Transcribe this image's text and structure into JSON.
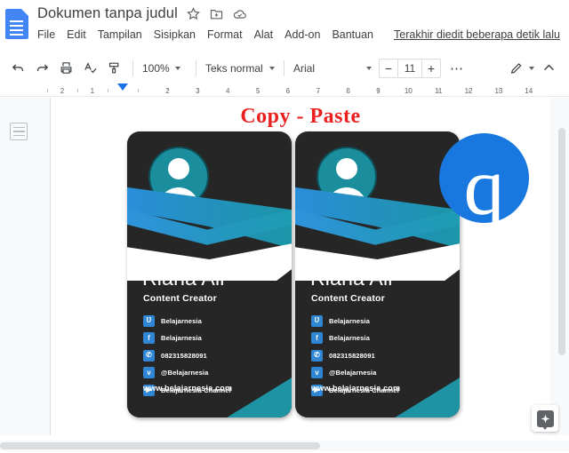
{
  "app": {
    "logo_icon": "google-docs-logo",
    "doc_title": "Dokumen tanpa judul",
    "title_icons": [
      "star-icon",
      "move-to-folder-icon",
      "cloud-saved-icon"
    ],
    "last_edit": "Terakhir diedit beberapa detik lalu"
  },
  "menu": {
    "items": [
      {
        "label": "File"
      },
      {
        "label": "Edit"
      },
      {
        "label": "Tampilan"
      },
      {
        "label": "Sisipkan"
      },
      {
        "label": "Format"
      },
      {
        "label": "Alat"
      },
      {
        "label": "Add-on"
      },
      {
        "label": "Bantuan"
      }
    ]
  },
  "toolbar": {
    "undo_icon": "undo-icon",
    "redo_icon": "redo-icon",
    "print_icon": "print-icon",
    "spellcheck_icon": "spellcheck-icon",
    "paint_format_icon": "paint-format-icon",
    "zoom_value": "100%",
    "paragraph_style": "Teks normal",
    "font_family": "Arial",
    "font_size": "11",
    "decrease_label": "−",
    "increase_label": "+",
    "more_label": "⋯",
    "edit_mode_icon": "pencil-icon",
    "collapse_icon": "chevron-up-icon"
  },
  "ruler": {
    "left_labels": [
      "2",
      "1"
    ],
    "right_labels": [
      "1",
      "2",
      "3",
      "4",
      "5",
      "6",
      "7",
      "8",
      "9",
      "10",
      "11",
      "12",
      "13",
      "14"
    ],
    "indent_marker": "indent-marker"
  },
  "sidebar": {
    "outline_icon": "document-outline-icon"
  },
  "document": {
    "heading": "Copy - Paste",
    "heading_color": "#ea2020",
    "cards": [
      {
        "name": "Riana Ali",
        "role": "Content Creator",
        "avatar_icon": "person-avatar-icon",
        "contacts": [
          {
            "icon": "vine-icon",
            "glyph": "Ʋ",
            "text": "Belajarnesia"
          },
          {
            "icon": "facebook-icon",
            "glyph": "f",
            "text": "Belajarnesia"
          },
          {
            "icon": "phone-icon",
            "glyph": "✆",
            "text": "082315828091"
          },
          {
            "icon": "twitter-icon",
            "glyph": "ᴠ",
            "text": "@Belajarnesia"
          },
          {
            "icon": "youtube-icon",
            "glyph": "▶",
            "text": "Belajarnesia Channel"
          }
        ],
        "website": "www.belajarnesia.com"
      },
      {
        "name": "Riana Ali",
        "role": "Content Creator",
        "avatar_icon": "person-avatar-icon",
        "contacts": [
          {
            "icon": "vine-icon",
            "glyph": "Ʋ",
            "text": "Belajarnesia"
          },
          {
            "icon": "facebook-icon",
            "glyph": "f",
            "text": "Belajarnesia"
          },
          {
            "icon": "phone-icon",
            "glyph": "✆",
            "text": "082315828091"
          },
          {
            "icon": "twitter-icon",
            "glyph": "ᴠ",
            "text": "@Belajarnesia"
          },
          {
            "icon": "youtube-icon",
            "glyph": "▶",
            "text": "Belajarnesia Channel"
          }
        ],
        "website": "www.belajarnesia.com"
      }
    ],
    "watermark": {
      "letter": "q",
      "color": "#1878e0"
    }
  },
  "controls": {
    "explore_icon": "explore-icon",
    "vertical_scrollbar": "vertical-scrollbar",
    "horizontal_scrollbar": "horizontal-scrollbar"
  },
  "theme": {
    "accent": "#1a73e8",
    "card_bg": "#262626",
    "card_teal": "#1d93a4",
    "card_blue": "#2f86d4"
  }
}
